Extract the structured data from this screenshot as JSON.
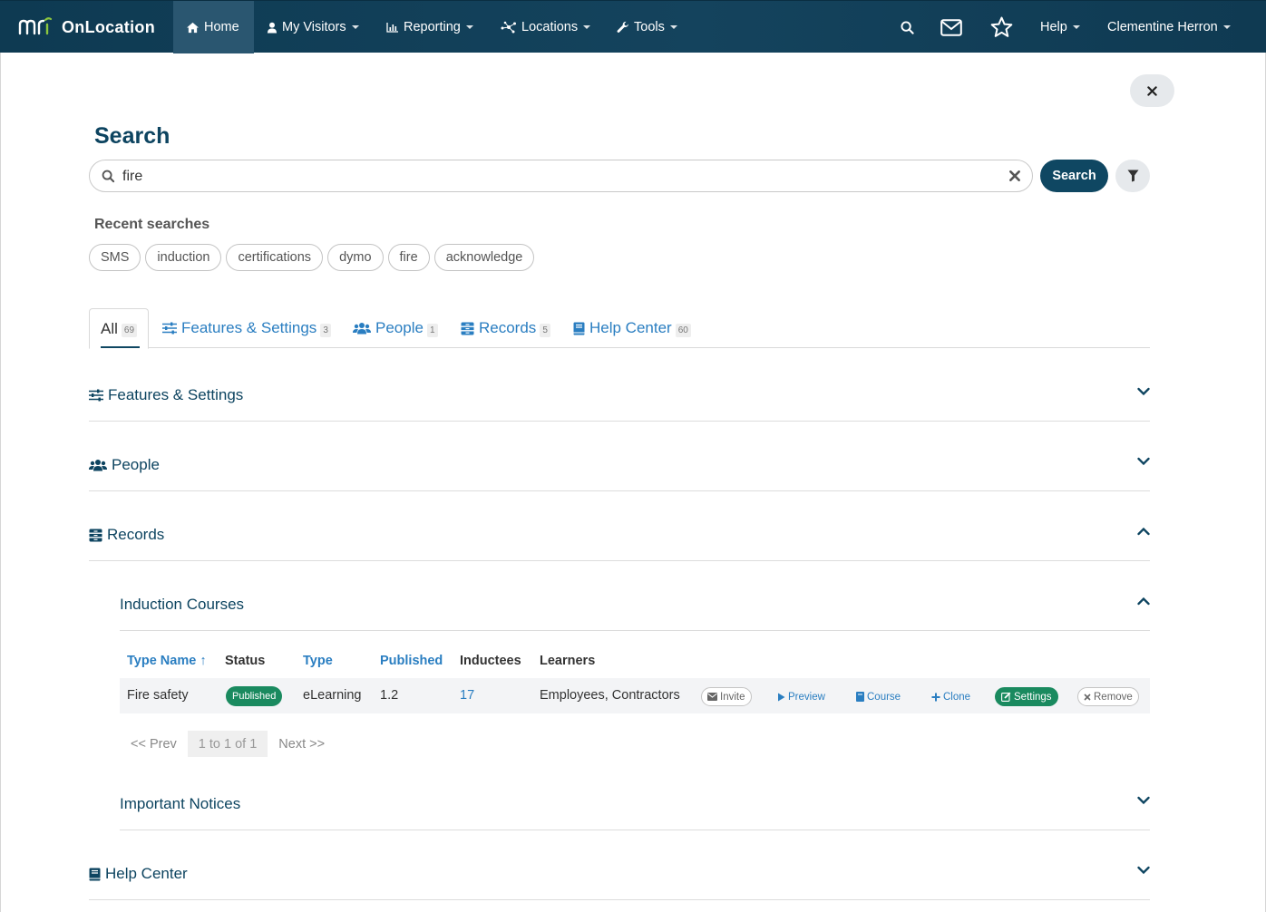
{
  "navbar": {
    "brand": "OnLocation",
    "items": [
      {
        "label": "Home"
      },
      {
        "label": "My Visitors"
      },
      {
        "label": "Reporting"
      },
      {
        "label": "Locations"
      },
      {
        "label": "Tools"
      }
    ],
    "help_label": "Help",
    "user_name": "Clementine Herron"
  },
  "page": {
    "title": "Search"
  },
  "search": {
    "value": "fire",
    "button_label": "Search"
  },
  "recent": {
    "label": "Recent searches",
    "items": [
      "SMS",
      "induction",
      "certifications",
      "dymo",
      "fire",
      "acknowledge"
    ]
  },
  "tabs": [
    {
      "label": "All",
      "count": "69"
    },
    {
      "label": "Features & Settings",
      "count": "3"
    },
    {
      "label": "People",
      "count": "1"
    },
    {
      "label": "Records",
      "count": "5"
    },
    {
      "label": "Help Center",
      "count": "60"
    }
  ],
  "sections": {
    "features": "Features & Settings",
    "people": "People",
    "records": "Records",
    "help": "Help Center"
  },
  "subsections": {
    "induction": "Induction Courses",
    "notices": "Important Notices"
  },
  "table": {
    "headers": {
      "type_name": "Type Name ↑",
      "status": "Status",
      "type": "Type",
      "published": "Published",
      "inductees": "Inductees",
      "learners": "Learners"
    },
    "rows": [
      {
        "type_name": "Fire safety",
        "status": "Published",
        "type": "eLearning",
        "published": "1.2",
        "inductees": "17",
        "learners": "Employees, Contractors",
        "actions": {
          "invite": "Invite",
          "preview": "Preview",
          "course": "Course",
          "clone": "Clone",
          "settings": "Settings",
          "remove": "Remove"
        }
      }
    ]
  },
  "pager": {
    "prev": "<< Prev",
    "current": "1 to 1 of 1",
    "next": "Next >>"
  },
  "colors": {
    "navbar": "#0e3a52",
    "primary": "#0f4762",
    "link": "#2a7ec1",
    "success": "#1a8a5f"
  },
  "icons": {
    "nav": [
      "home-icon",
      "user-icon",
      "chart-icon",
      "network-icon",
      "wrench-icon",
      "search-icon",
      "envelope-icon",
      "star-icon"
    ],
    "controls": [
      "close-icon",
      "search-icon",
      "clear-icon",
      "filter-icon",
      "chevron-down-icon",
      "chevron-up-icon"
    ]
  }
}
